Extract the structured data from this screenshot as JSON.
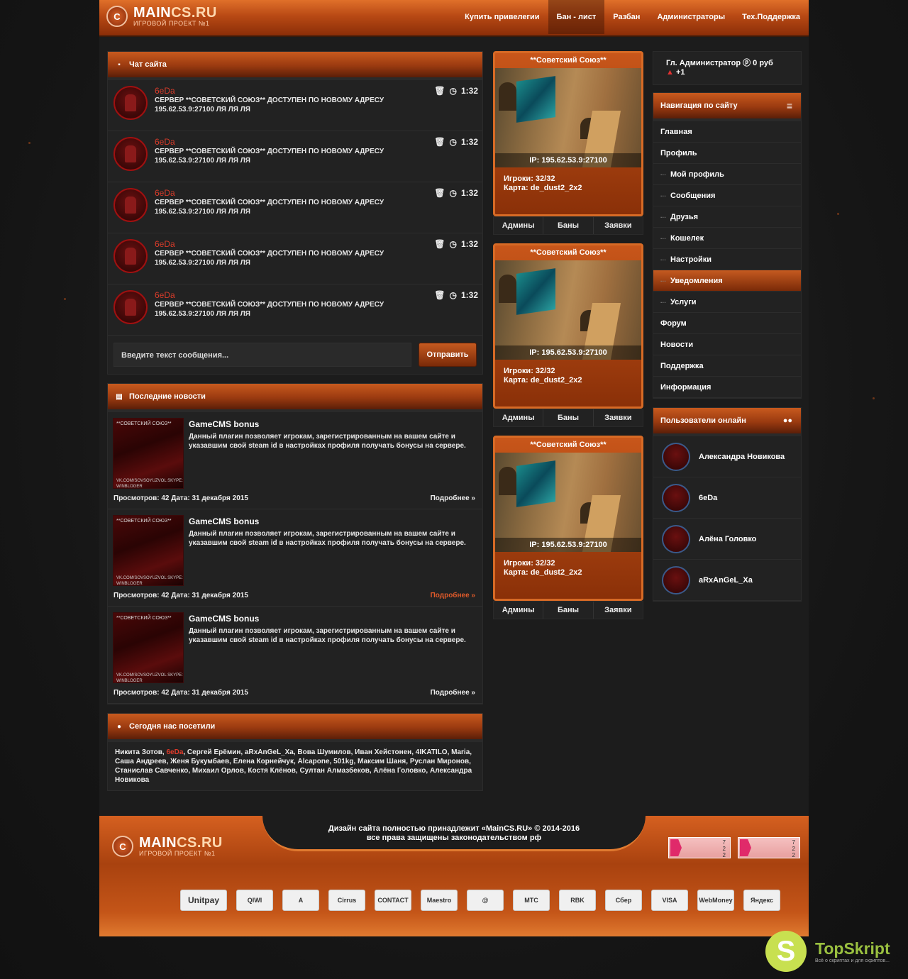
{
  "site": {
    "logo_main": "MAIN",
    "logo_accent": "CS.RU",
    "logo_sub": "ИГРОВОЙ ПРОЕКТ №1"
  },
  "nav": [
    "Купить привелегии",
    "Бан - лист",
    "Разбан",
    "Администраторы",
    "Тех.Поддержка"
  ],
  "chat": {
    "title": "Чат сайта",
    "messages": [
      {
        "author": "6eDa",
        "text": "СЕРВЕР **СОВЕТСКИЙ СОЮЗ** ДОСТУПЕН ПО НОВОМУ АДРЕСУ 195.62.53.9:27100 ЛЯ ЛЯ ЛЯ",
        "time": "1:32"
      },
      {
        "author": "6eDa",
        "text": "СЕРВЕР **СОВЕТСКИЙ СОЮЗ** ДОСТУПЕН ПО НОВОМУ АДРЕСУ 195.62.53.9:27100 ЛЯ ЛЯ ЛЯ",
        "time": "1:32"
      },
      {
        "author": "6eDa",
        "text": "СЕРВЕР **СОВЕТСКИЙ СОЮЗ** ДОСТУПЕН ПО НОВОМУ АДРЕСУ 195.62.53.9:27100 ЛЯ ЛЯ ЛЯ",
        "time": "1:32"
      },
      {
        "author": "6eDa",
        "text": "СЕРВЕР **СОВЕТСКИЙ СОЮЗ** ДОСТУПЕН ПО НОВОМУ АДРЕСУ 195.62.53.9:27100 ЛЯ ЛЯ ЛЯ",
        "time": "1:32"
      },
      {
        "author": "6eDa",
        "text": "СЕРВЕР **СОВЕТСКИЙ СОЮЗ** ДОСТУПЕН ПО НОВОМУ АДРЕСУ 195.62.53.9:27100 ЛЯ ЛЯ ЛЯ",
        "time": "1:32"
      }
    ],
    "input_placeholder": "Введите текст сообщения...",
    "send_label": "Отправить"
  },
  "news": {
    "title": "Последние новости",
    "items": [
      {
        "title": "GameCMS bonus",
        "text": "Данный плагин позволяет игрокам, зарегистрированным на вашем сайте и указавшим свой steam id в настройках профиля получать бонусы на сервере.",
        "views": "Просмотров: 42",
        "date": "Дата: 31 декабря 2015",
        "more": "Подробнее »"
      },
      {
        "title": "GameCMS bonus",
        "text": "Данный плагин позволяет игрокам, зарегистрированным на вашем сайте и указавшим свой steam id в настройках профиля получать бонусы на сервере.",
        "views": "Просмотров: 42",
        "date": "Дата: 31 декабря 2015",
        "more": "Подробнее »"
      },
      {
        "title": "GameCMS bonus",
        "text": "Данный плагин позволяет игрокам, зарегистрированным на вашем сайте и указавшим свой steam id в настройках профиля получать бонусы на сервере.",
        "views": "Просмотров: 42",
        "date": "Дата: 31 декабря 2015",
        "more": "Подробнее »"
      }
    ],
    "thumb_top": "**СОВЕТСКИЙ СОЮЗ**",
    "thumb_bottom": "VK.COM/SOVSOYUZVOL SKYPE: WINBLOGER"
  },
  "visitors": {
    "title": "Сегодня нас посетили",
    "names_before": "Никита Зотов, ",
    "highlight": "6eDa",
    "names_after": ", Сергей Ерёмин, aRxAnGeL_Xa, Вова Шумилов, Иван Хейстонен, 4IKATILO, Maria, Саша Андреев, Женя Букумбаев, Елена Корнейчук, Alcapone, 501kg, Максим Шаня, Руслан Миронов, Станислав Савченко, Михаил Орлов, Костя Клёнов, Султан Алмазбеков, Алёна Головко, Александра Новикова"
  },
  "servers": [
    {
      "name": "**Советский Союз**",
      "ip": "IP: 195.62.53.9:27100",
      "players": "Игроки: 32/32",
      "map": "Карта: de_dust2_2x2",
      "btns": [
        "Админы",
        "Баны",
        "Заявки"
      ]
    },
    {
      "name": "**Советский Союз**",
      "ip": "IP: 195.62.53.9:27100",
      "players": "Игроки: 32/32",
      "map": "Карта: de_dust2_2x2",
      "btns": [
        "Админы",
        "Баны",
        "Заявки"
      ]
    },
    {
      "name": "**Советский Союз**",
      "ip": "IP: 195.62.53.9:27100",
      "players": "Игроки: 32/32",
      "map": "Карта: de_dust2_2x2",
      "btns": [
        "Админы",
        "Баны",
        "Заявки"
      ]
    }
  ],
  "account": {
    "role": "Гл. Администратор",
    "balance": "0 руб",
    "reputation": "+1"
  },
  "navigation": {
    "title": "Навигация по сайту",
    "items": [
      {
        "label": "Главная",
        "sub": false
      },
      {
        "label": "Профиль",
        "sub": false
      },
      {
        "label": "Мой профиль",
        "sub": true
      },
      {
        "label": "Сообщения",
        "sub": true
      },
      {
        "label": "Друзья",
        "sub": true
      },
      {
        "label": "Кошелек",
        "sub": true
      },
      {
        "label": "Настройки",
        "sub": true
      },
      {
        "label": "Уведомления",
        "sub": true,
        "active": true
      },
      {
        "label": "Услуги",
        "sub": true
      },
      {
        "label": "Форум",
        "sub": false
      },
      {
        "label": "Новости",
        "sub": false
      },
      {
        "label": "Поддержка",
        "sub": false
      },
      {
        "label": "Информация",
        "sub": false
      }
    ]
  },
  "online": {
    "title": "Пользователи онлайн",
    "users": [
      "Александра Новикова",
      "6eDa",
      "Алёна Головко",
      "aRxAnGeL_Xa"
    ]
  },
  "footer": {
    "copy_line1": "Дизайн сайта полностью принадлежит «MainCS.RU» © 2014-2016",
    "copy_line2": "все права защищены законодательством рф",
    "counter_values": [
      "7",
      "2",
      "2"
    ],
    "payments": [
      "Unitpay",
      "QIWI",
      "А",
      "Cirrus",
      "CONTACT",
      "Maestro",
      "@",
      "МТС",
      "RBK",
      "Сбер",
      "VISA",
      "WebMoney",
      "Яндекс"
    ]
  },
  "watermark": {
    "letter": "S",
    "title": "TopSkript",
    "sub": "Всё о скриптах и для скриптов..."
  },
  "colors": {
    "accent": "#c8561a",
    "accent_dark": "#7a2a08",
    "highlight_red": "#d63b2a"
  }
}
